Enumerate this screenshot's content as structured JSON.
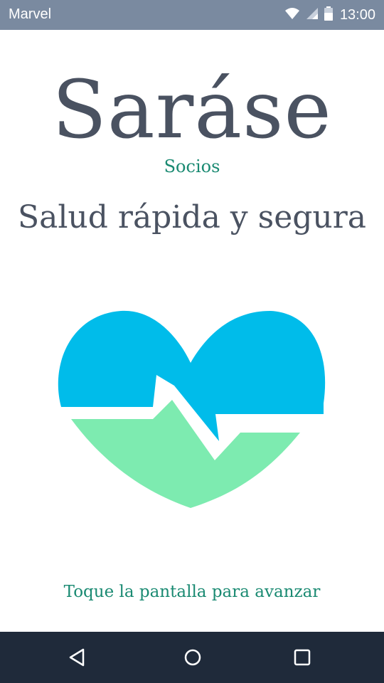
{
  "status_bar": {
    "app_name": "Marvel",
    "time": "13:00",
    "icons": [
      "wifi-icon",
      "signal-icon",
      "battery-icon"
    ]
  },
  "brand": {
    "title": "Saráse",
    "subtitle": "Socios"
  },
  "tagline": "Salud rápida y segura",
  "logo": {
    "icon": "heartbeat-heart-icon",
    "colors": {
      "top": "#00bcea",
      "bottom": "#7debb0"
    }
  },
  "tap_hint": "Toque la pantalla para avanzar",
  "nav_bar": {
    "icons": [
      "back-icon",
      "home-icon",
      "recents-icon"
    ]
  },
  "colors": {
    "status_bar": "#7a8aa0",
    "nav_bar": "#1f2a3a",
    "title_text": "#4a5261",
    "accent_text": "#1a8a72"
  }
}
